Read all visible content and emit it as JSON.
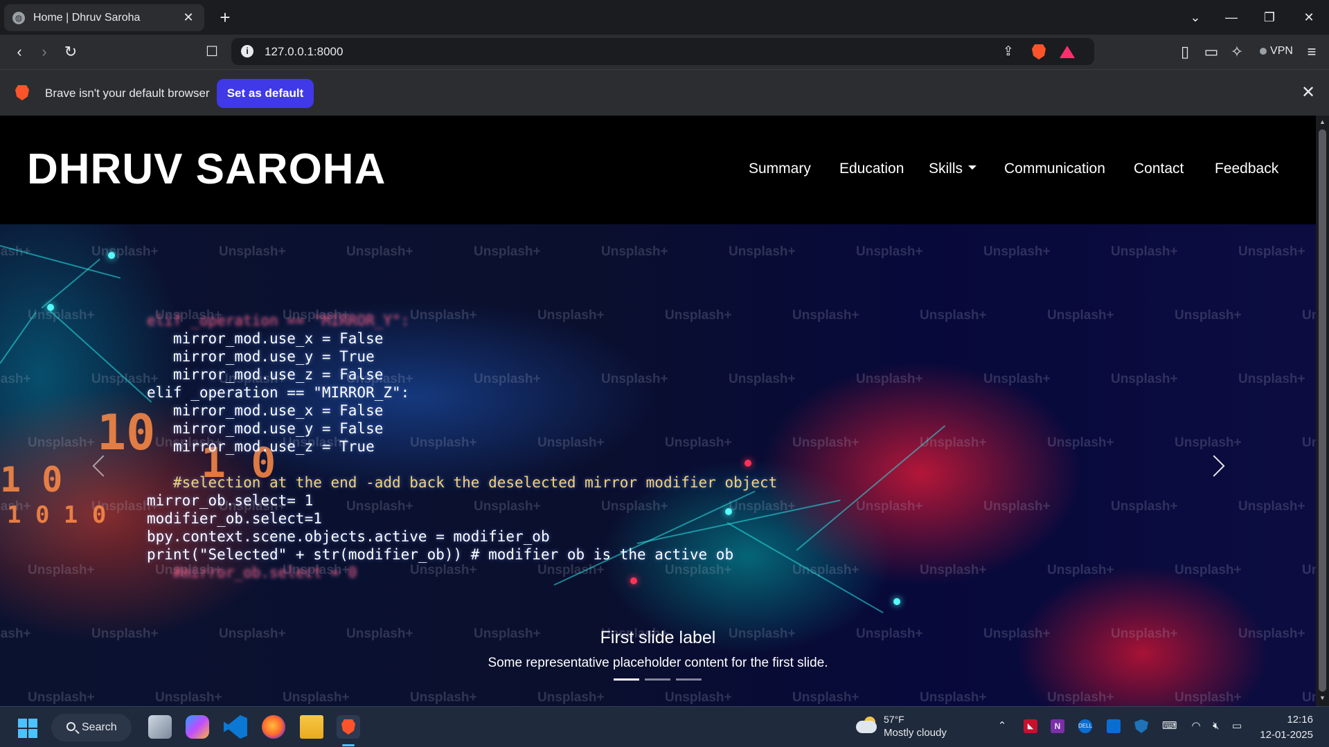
{
  "browser": {
    "tab_title": "Home | Dhruv Saroha",
    "url": "127.0.0.1:8000",
    "vpn_label": "VPN",
    "infobar_message": "Brave isn't your default browser",
    "set_default_label": "Set as default",
    "accent": "#3f39e8"
  },
  "site": {
    "brand": "DHRUV SAROHA",
    "nav": [
      "Summary",
      "Education",
      "Skills",
      "Communication",
      "Contact",
      "Feedback"
    ]
  },
  "carousel": {
    "caption_title": "First slide label",
    "caption_text": "Some representative placeholder content for the first slide.",
    "watermark": "Unsplash+",
    "slide_count": 3,
    "active_slide": 1,
    "code_lines": [
      "elif _operation == \"MIRROR_Y\":",
      "   mirror_mod.use_x = False",
      "   mirror_mod.use_y = True",
      "   mirror_mod.use_z = False",
      "elif _operation == \"MIRROR_Z\":",
      "   mirror_mod.use_x = False",
      "   mirror_mod.use_y = False",
      "   mirror_mod.use_z = True",
      "",
      "   #selection at the end -add back the deselected mirror modifier object",
      "mirror_ob.select= 1",
      "modifier_ob.select=1",
      "bpy.context.scene.objects.active = modifier_ob",
      "print(\"Selected\" + str(modifier_ob)) # modifier ob is the active ob",
      "   #mirror_ob.select = 0"
    ]
  },
  "taskbar": {
    "search_label": "Search",
    "weather_temp": "57°F",
    "weather_cond": "Mostly cloudy",
    "time": "12:16",
    "date": "12-01-2025"
  }
}
